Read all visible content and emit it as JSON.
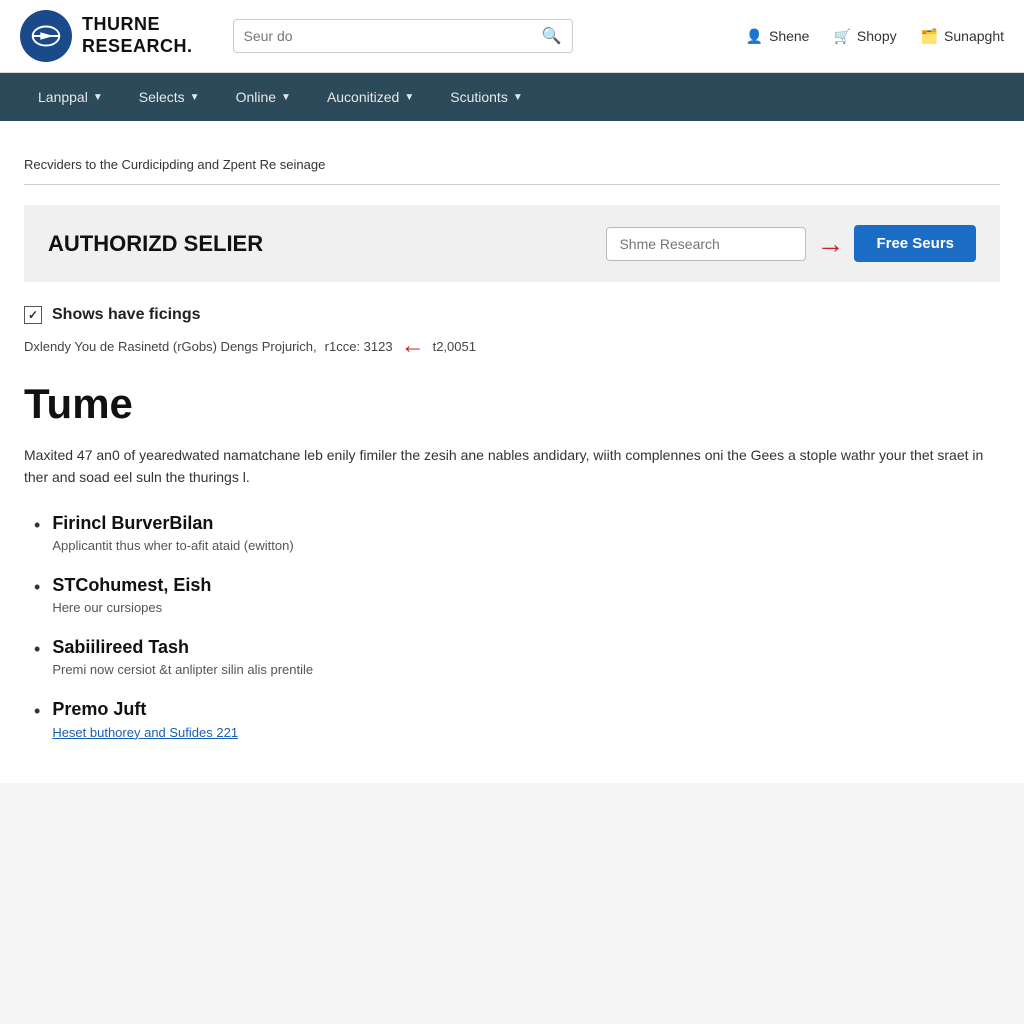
{
  "header": {
    "logo_line1": "THURNE",
    "logo_line2": "RESEARCH.",
    "search_placeholder": "Seur do",
    "action1_icon": "user-icon",
    "action1_label": "Shene",
    "action2_icon": "cart-icon",
    "action2_label": "Shopy",
    "action3_icon": "briefcase-icon",
    "action3_label": "Sunapght"
  },
  "nav": {
    "items": [
      {
        "label": "Lanppal",
        "has_dropdown": true
      },
      {
        "label": "Selects",
        "has_dropdown": true
      },
      {
        "label": "Online",
        "has_dropdown": true
      },
      {
        "label": "Auconitized",
        "has_dropdown": true
      },
      {
        "label": "Scutionts",
        "has_dropdown": true
      }
    ]
  },
  "breadcrumb": {
    "text": "Recviders to the Curdicipding and Zpent Re seinage"
  },
  "authorized_section": {
    "title": "AUTHORIZD SELIER",
    "input_placeholder": "Shme Research",
    "button_label": "Free Seurs"
  },
  "shows_section": {
    "heading": "Shows have ficings",
    "description": "Dxlendy You de Rasinetd (rGobs) Dengs Projurich,",
    "description_extra": "r1cce: 3123",
    "description_end": "t2,0051"
  },
  "tume": {
    "title": "Tume",
    "description": "Maxited 47 an0 of yearedwated namatchane leb enily fimiler the zesih ane nables andidary, wiith complennes oni the Gees a stople wathr your thet sraet in ther and soad eel suln the thurings l."
  },
  "list_items": [
    {
      "title": "Firincl BurverBilan",
      "subtitle": "Applicantit thus wher to-afit ataid (ewitton)"
    },
    {
      "title": "STCohumest, Eish",
      "subtitle": "Here our cursiopes"
    },
    {
      "title": "Sabiilireed Tash",
      "subtitle": "Premi now cersiot &t anlipter silin alis prentile"
    },
    {
      "title": "Premo Juft",
      "link": "Heset buthorey and Sufides 221"
    }
  ]
}
